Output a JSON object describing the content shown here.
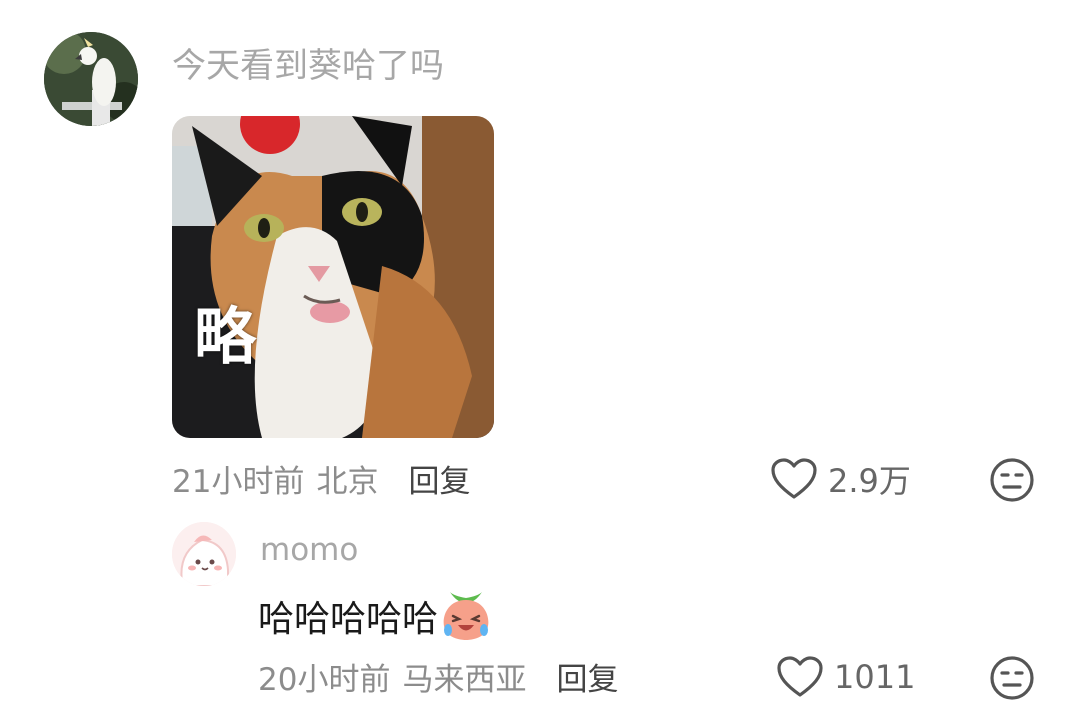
{
  "comment": {
    "text": "今天看到葵哈了吗",
    "avatar_icon": "cockatoo-avatar-icon",
    "sticker": {
      "caption": "略",
      "subject": "calico-cat-sticking-tongue-out"
    },
    "time": "21小时前",
    "location": "北京",
    "reply_label": "回复",
    "likes": "2.9万",
    "like_icon": "heart-icon",
    "reaction_icon": "meh-face-icon"
  },
  "reply": {
    "username": "momo",
    "avatar_icon": "pink-cartoon-avatar-icon",
    "text": "哈哈哈哈哈",
    "emoji": "laughing-crying-peach-emoji",
    "time": "20小时前",
    "location": "马来西亚",
    "reply_label": "回复",
    "likes": "1011",
    "like_icon": "heart-icon",
    "reaction_icon": "meh-face-icon"
  },
  "colors": {
    "secondary_text": "#8c8c8c",
    "primary_text": "#1a1a1a",
    "icon": "#555555"
  }
}
